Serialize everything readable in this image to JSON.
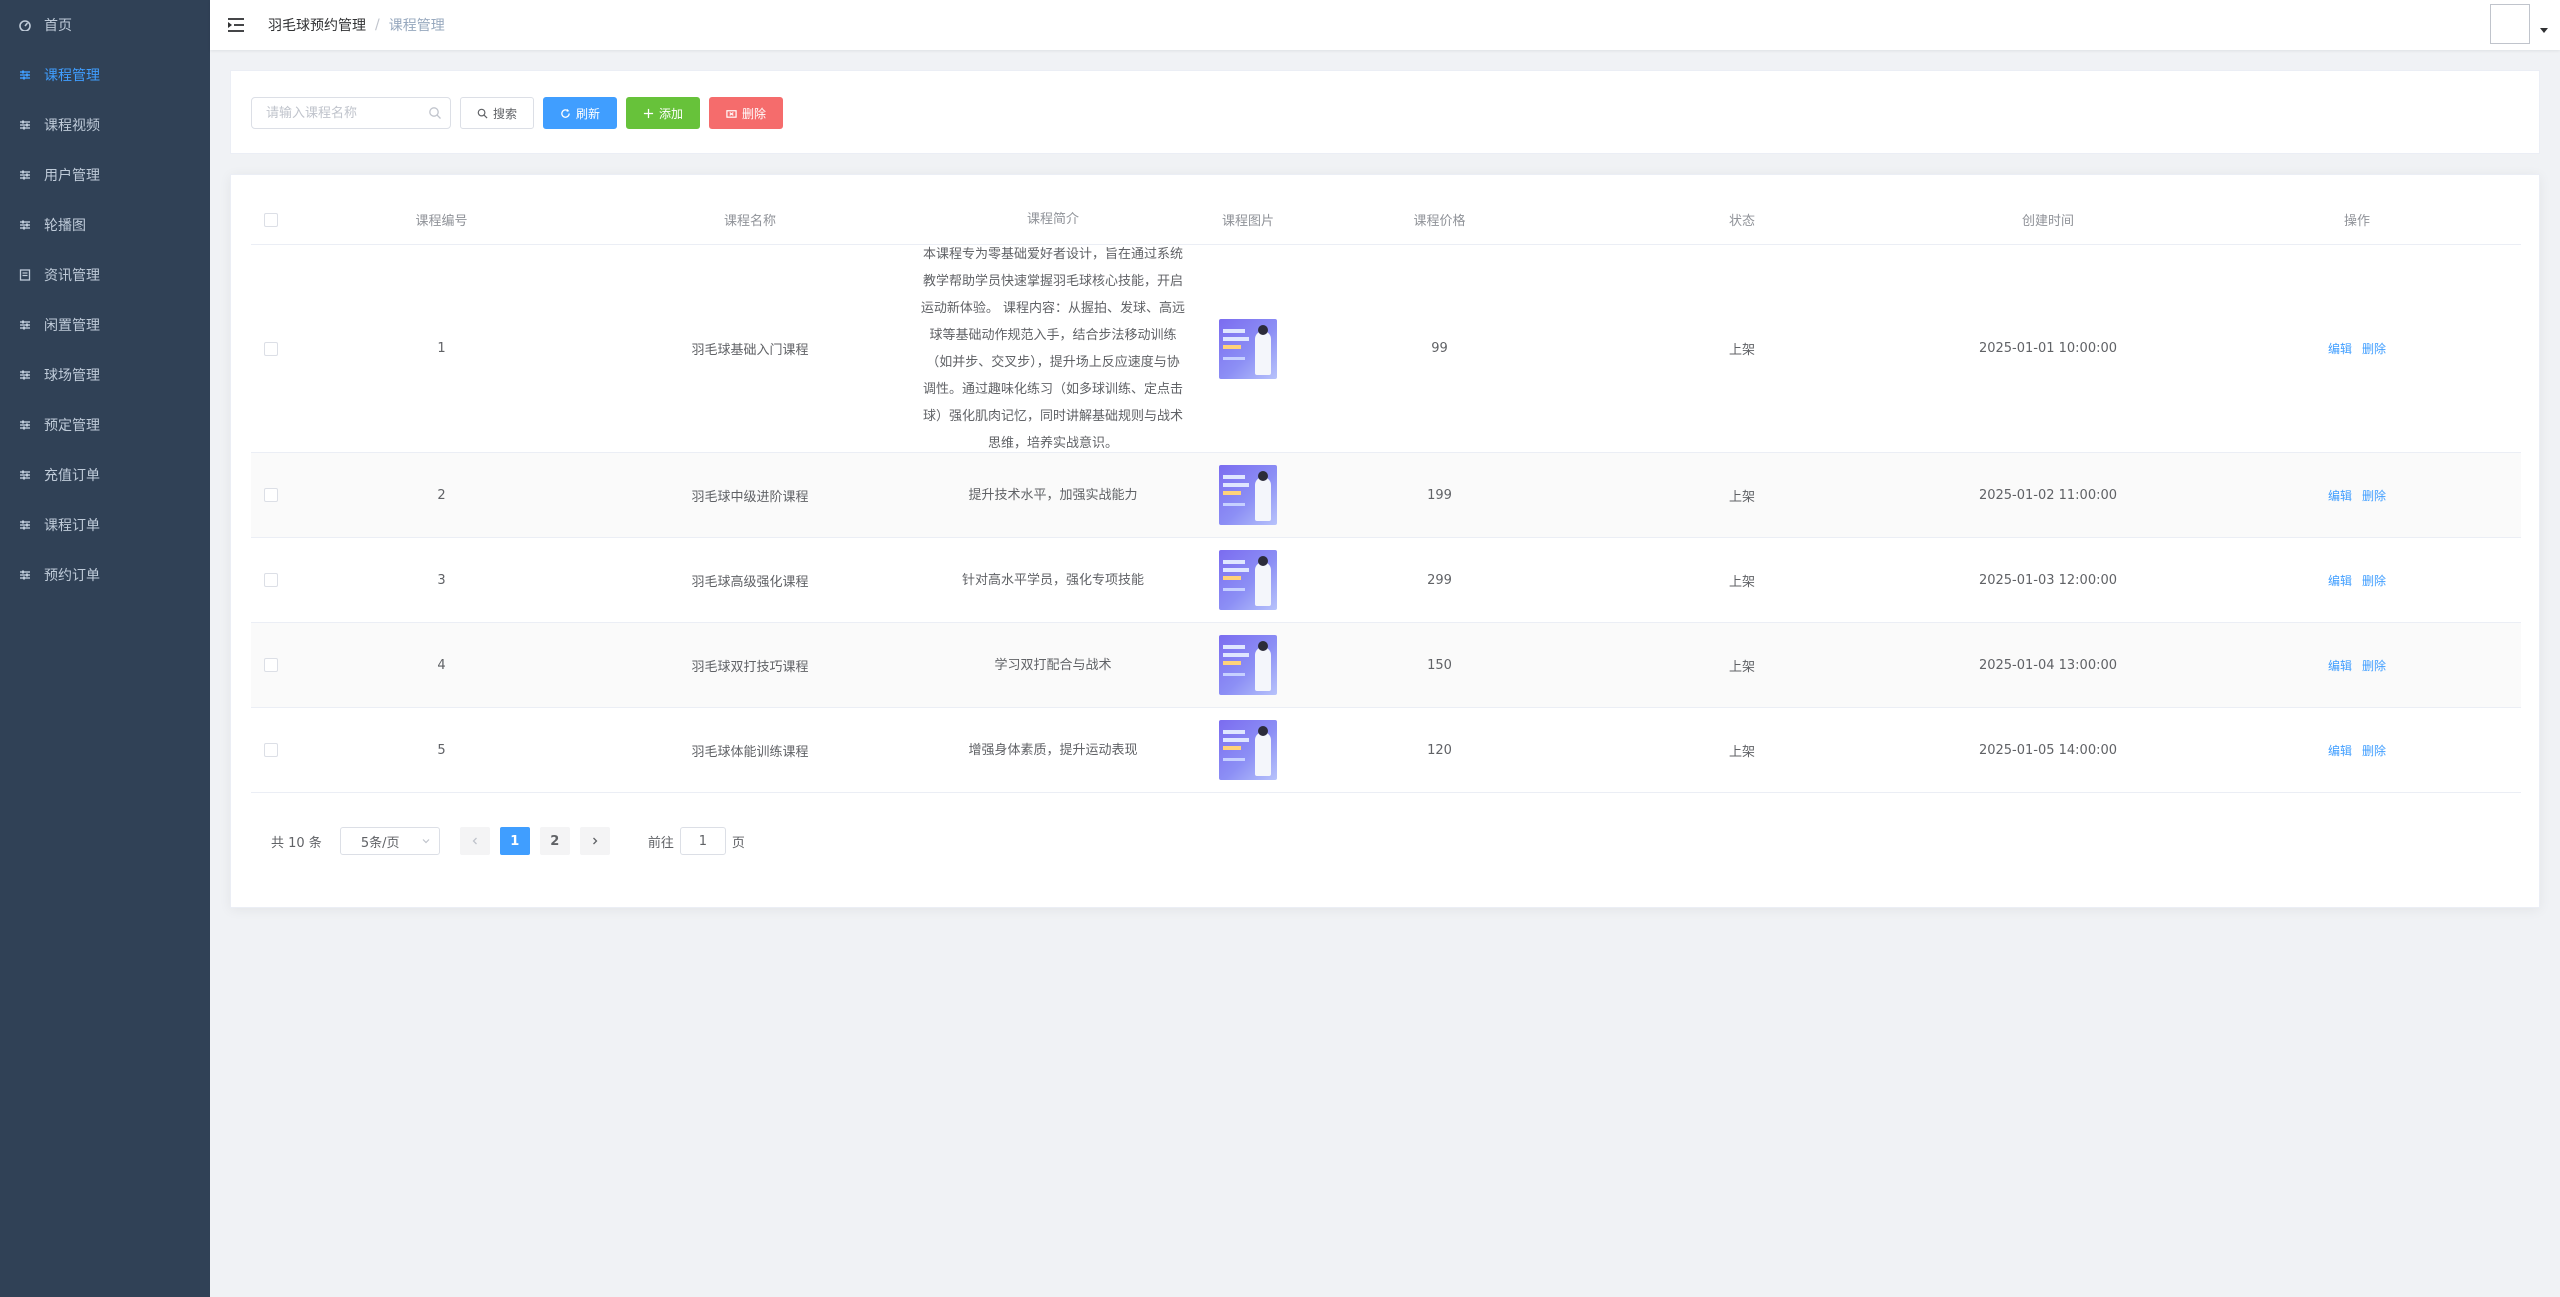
{
  "sidebar": {
    "items": [
      {
        "label": "首页",
        "icon": "dashboard-icon",
        "active": false
      },
      {
        "label": "课程管理",
        "icon": "sliders-icon",
        "active": true
      },
      {
        "label": "课程视频",
        "icon": "sliders-icon",
        "active": false
      },
      {
        "label": "用户管理",
        "icon": "sliders-icon",
        "active": false
      },
      {
        "label": "轮播图",
        "icon": "sliders-icon",
        "active": false
      },
      {
        "label": "资讯管理",
        "icon": "document-icon",
        "active": false
      },
      {
        "label": "闲置管理",
        "icon": "sliders-icon",
        "active": false
      },
      {
        "label": "球场管理",
        "icon": "sliders-icon",
        "active": false
      },
      {
        "label": "预定管理",
        "icon": "sliders-icon",
        "active": false
      },
      {
        "label": "充值订单",
        "icon": "sliders-icon",
        "active": false
      },
      {
        "label": "课程订单",
        "icon": "sliders-icon",
        "active": false
      },
      {
        "label": "预约订单",
        "icon": "sliders-icon",
        "active": false
      }
    ]
  },
  "header": {
    "breadcrumb": [
      "羽毛球预约管理",
      "课程管理"
    ],
    "separator": "/"
  },
  "toolbar": {
    "search_placeholder": "请输入课程名称",
    "search_label": "搜索",
    "refresh_label": "刷新",
    "add_label": "添加",
    "delete_label": "删除"
  },
  "table": {
    "columns": [
      "课程编号",
      "课程名称",
      "课程简介",
      "课程图片",
      "课程价格",
      "状态",
      "创建时间",
      "操作"
    ],
    "rows": [
      {
        "id": "1",
        "name": "羽毛球基础入门课程",
        "desc": "本课程专为零基础爱好者设计，旨在通过系统教学帮助学员快速掌握羽毛球核心技能，开启运动新体验。 课程内容：从握拍、发球、高远球等基础动作规范入手，结合步法移动训练（如并步、交叉步），提升场上反应速度与协调性。通过趣味化练习（如多球训练、定点击球）强化肌肉记忆，同时讲解基础规则与战术思维，培养实战意识。",
        "price": "99",
        "status": "上架",
        "time": "2025-01-01 10:00:00"
      },
      {
        "id": "2",
        "name": "羽毛球中级进阶课程",
        "desc": "提升技术水平，加强实战能力",
        "price": "199",
        "status": "上架",
        "time": "2025-01-02 11:00:00"
      },
      {
        "id": "3",
        "name": "羽毛球高级强化课程",
        "desc": "针对高水平学员，强化专项技能",
        "price": "299",
        "status": "上架",
        "time": "2025-01-03 12:00:00"
      },
      {
        "id": "4",
        "name": "羽毛球双打技巧课程",
        "desc": "学习双打配合与战术",
        "price": "150",
        "status": "上架",
        "time": "2025-01-04 13:00:00"
      },
      {
        "id": "5",
        "name": "羽毛球体能训练课程",
        "desc": "增强身体素质，提升运动表现",
        "price": "120",
        "status": "上架",
        "time": "2025-01-05 14:00:00"
      }
    ],
    "edit_label": "编辑",
    "delete_label": "删除"
  },
  "pagination": {
    "total_text": "共 10 条",
    "page_size": "5条/页",
    "pages": [
      "1",
      "2"
    ],
    "current_page": "1",
    "goto_prefix": "前往",
    "goto_value": "1",
    "goto_suffix": "页"
  },
  "colors": {
    "sidebar_bg": "#304156",
    "primary": "#409eff",
    "success": "#67c23a",
    "danger": "#f56c6c"
  }
}
